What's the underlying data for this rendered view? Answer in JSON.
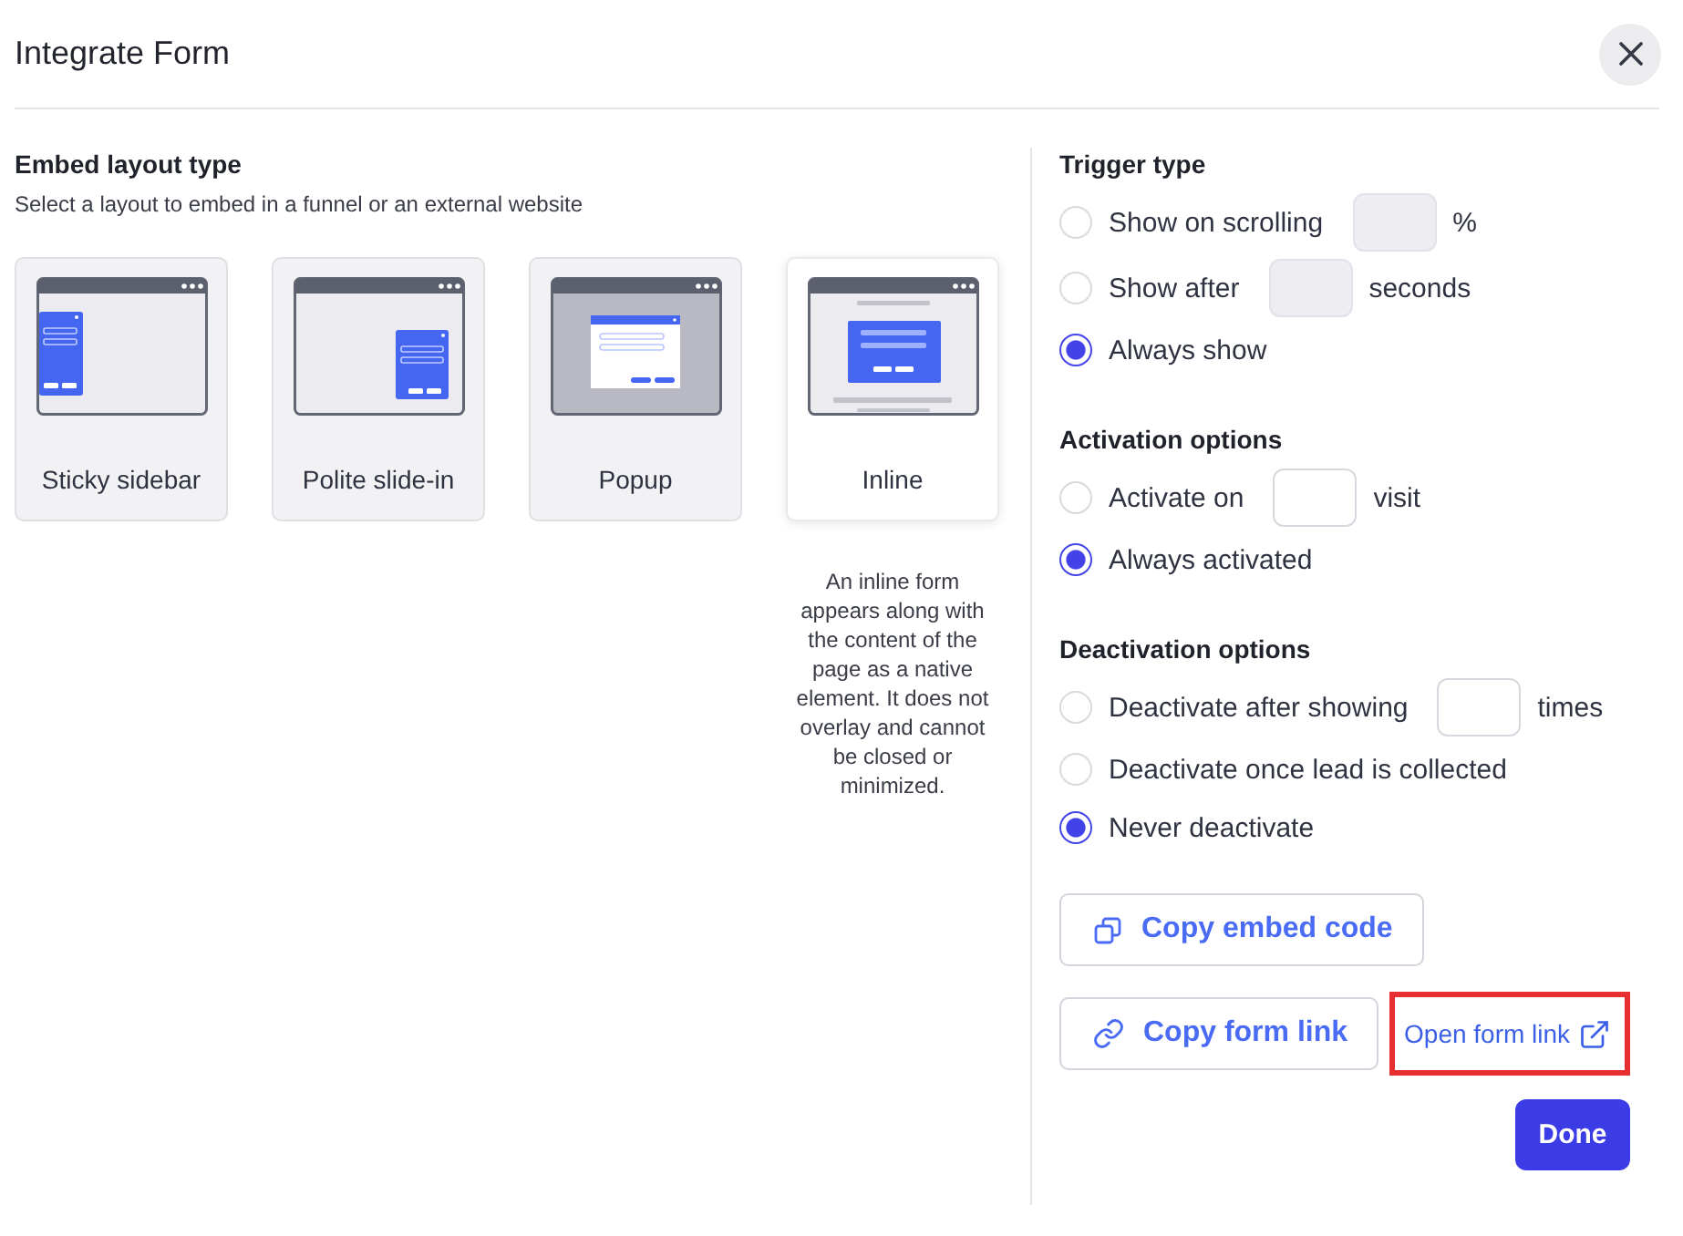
{
  "dialog": {
    "title": "Integrate Form"
  },
  "embed_layout": {
    "heading": "Embed layout type",
    "subtitle": "Select a layout to embed in a funnel or an external website",
    "layouts": [
      {
        "kind": "sidebar",
        "label": "Sticky sidebar",
        "selected": false
      },
      {
        "kind": "slide_in",
        "label": "Polite slide-in",
        "selected": false
      },
      {
        "kind": "popup",
        "label": "Popup",
        "selected": false
      },
      {
        "kind": "inline",
        "label": "Inline",
        "selected": true,
        "description": "An inline form appears along with the content of the page as a native element. It does not overlay and cannot be closed or minimized."
      }
    ]
  },
  "settings": [
    {
      "heading": "Trigger type",
      "options": [
        {
          "label": "Show on scrolling",
          "selected": false,
          "input": {
            "unit": "%",
            "disabled": true
          }
        },
        {
          "label": "Show after",
          "selected": false,
          "input": {
            "unit": "seconds",
            "disabled": true
          }
        },
        {
          "label": "Always show",
          "selected": true
        }
      ]
    },
    {
      "heading": "Activation options",
      "options": [
        {
          "label": "Activate on",
          "selected": false,
          "input": {
            "unit": "visit",
            "disabled": false
          }
        },
        {
          "label": "Always activated",
          "selected": true
        }
      ]
    },
    {
      "heading": "Deactivation options",
      "options": [
        {
          "label": "Deactivate after showing",
          "selected": false,
          "input": {
            "unit": "times",
            "disabled": false
          }
        },
        {
          "label": "Deactivate once lead is collected",
          "selected": false
        },
        {
          "label": "Never deactivate",
          "selected": true
        }
      ]
    }
  ],
  "actions": {
    "copy_embed": {
      "label": "Copy embed code"
    },
    "copy_link": {
      "label": "Copy form link"
    },
    "open_link": {
      "label": "Open form link",
      "highlighted": true
    },
    "done": {
      "label": "Done"
    }
  }
}
